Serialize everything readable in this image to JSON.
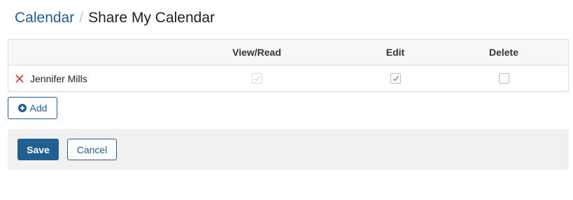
{
  "breadcrumb": {
    "parent": "Calendar",
    "separator": "/",
    "current": "Share My Calendar"
  },
  "table": {
    "columns": [
      "View/Read",
      "Edit",
      "Delete"
    ],
    "rows": [
      {
        "name": "Jennifer Mills",
        "view_read": true,
        "view_read_disabled": true,
        "edit": true,
        "delete": false
      }
    ]
  },
  "add_label": "Add",
  "actions": {
    "save_label": "Save",
    "cancel_label": "Cancel"
  },
  "colors": {
    "accent": "#1f5f93",
    "remove": "#d9302c"
  },
  "icons": {
    "remove": "close-icon",
    "add": "plus-circle-icon",
    "check": "checkmark-icon"
  }
}
